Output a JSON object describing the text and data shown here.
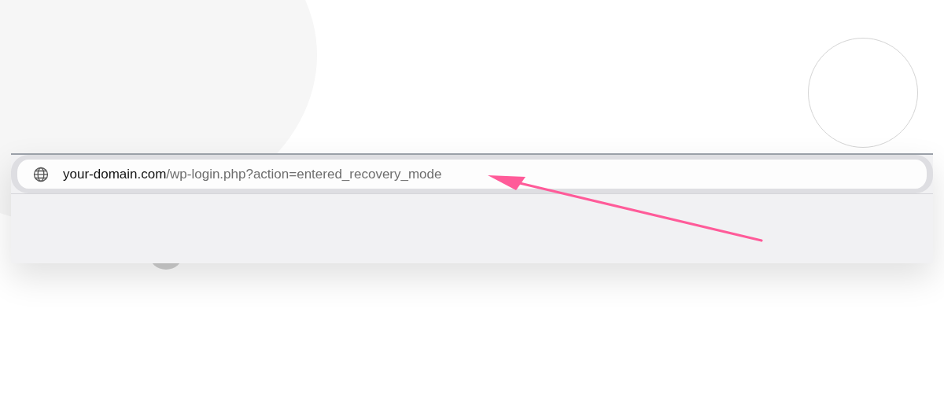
{
  "address_bar": {
    "domain": "your-domain.com",
    "path": "/wp-login.php?action=entered_recovery_mode"
  }
}
